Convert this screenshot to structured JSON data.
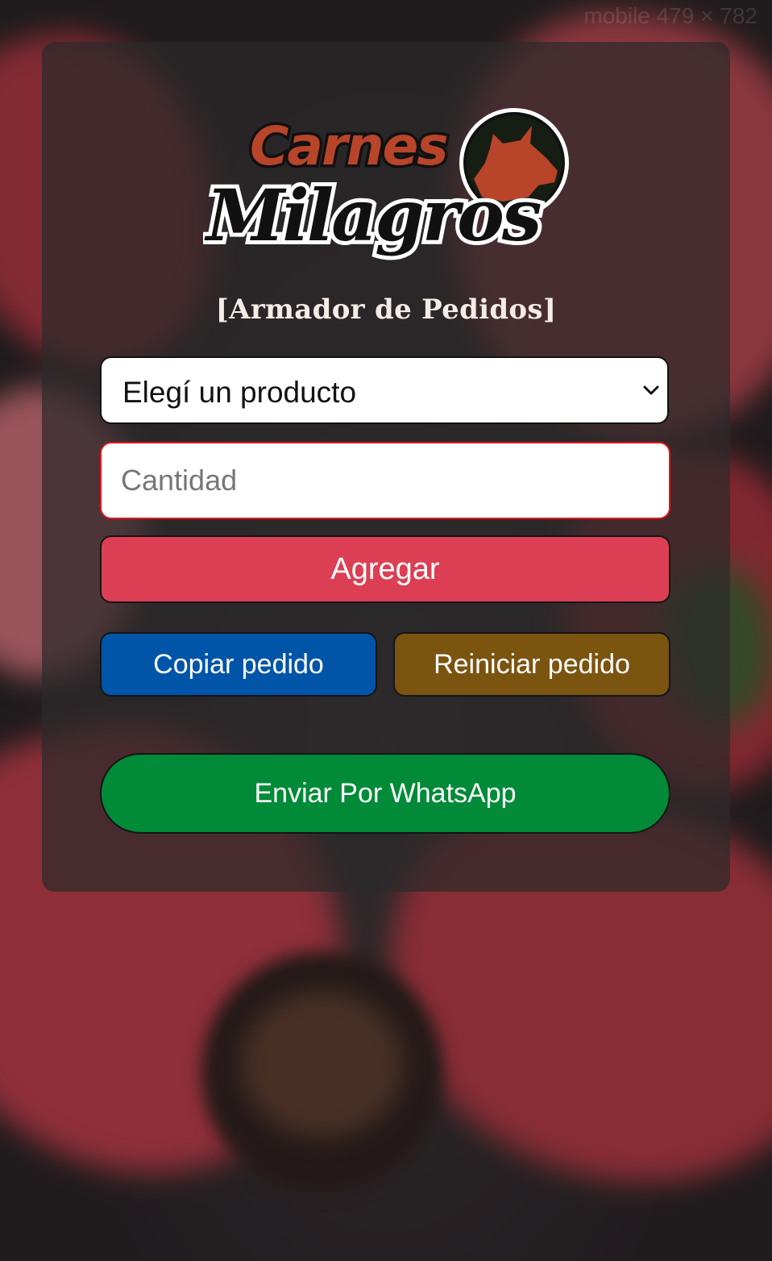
{
  "watermark": "mobile 479 × 782",
  "brand": {
    "line1": "Carnes",
    "line2": "Milagros",
    "emblem_icon": "cow-head-icon",
    "colors": {
      "accent": "#b8442a",
      "ink": "#111111",
      "emblem_bg": "#161e14"
    }
  },
  "subtitle": "[Armador de Pedidos]",
  "form": {
    "product_select": {
      "selected": "Elegí un producto"
    },
    "quantity_input": {
      "placeholder": "Cantidad",
      "value": ""
    },
    "add_label": "Agregar"
  },
  "actions": {
    "copy_label": "Copiar pedido",
    "reset_label": "Reiniciar pedido",
    "whatsapp_label": "Enviar Por WhatsApp"
  },
  "colors": {
    "add": "#dc3f53",
    "copy": "#0055a8",
    "reset": "#7b5410",
    "whatsapp": "#018a38",
    "quantity_border": "#e0161b"
  }
}
